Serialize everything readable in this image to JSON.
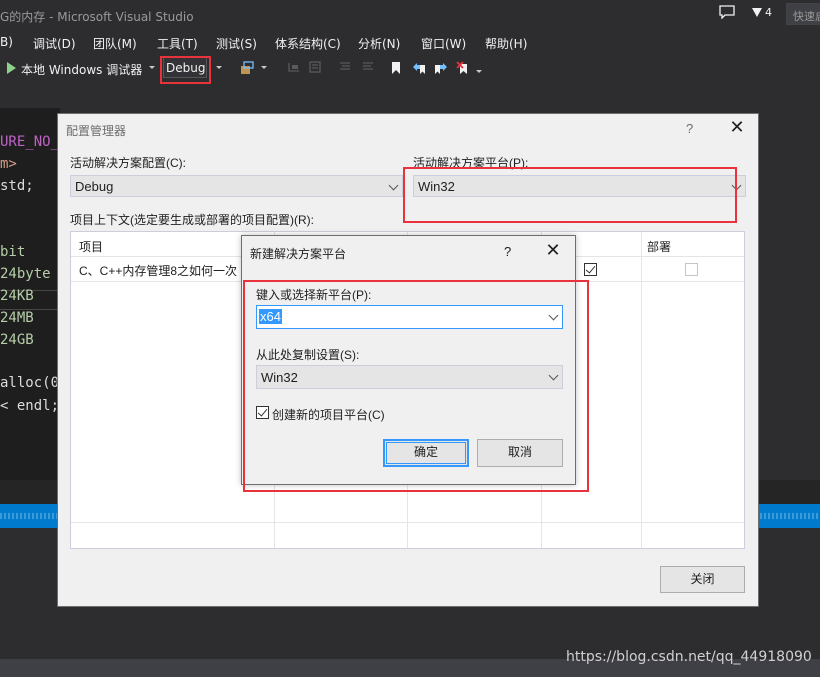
{
  "window": {
    "title": "G的内存 - Microsoft Visual Studio",
    "notification_count": "4",
    "quick_launch": "快速启"
  },
  "menu": {
    "items": [
      "B)",
      "调试(D)",
      "团队(M)",
      "工具(T)",
      "测试(S)",
      "体系结构(C)",
      "分析(N)",
      "窗口(W)",
      "帮助(H)"
    ]
  },
  "toolbar": {
    "run_label": "本地 Windows 调试器",
    "configuration": "Debug"
  },
  "editor": {
    "lines": [
      "URE_NO_",
      "m>",
      "std;",
      "",
      "bit",
      "24byte",
      "24KB",
      "24MB",
      "24GB",
      "",
      "alloc(0",
      "< endl;"
    ]
  },
  "config_manager": {
    "title": "配置管理器",
    "help": "?",
    "close": "✕",
    "active_config_label": "活动解决方案配置(C):",
    "active_config_value": "Debug",
    "active_platform_label": "活动解决方案平台(P):",
    "active_platform_value": "Win32",
    "project_context_label": "项目上下文(选定要生成或部署的项目配置)(R):",
    "columns": [
      "项目",
      "部署"
    ],
    "rows": [
      {
        "project": "C、C++内存管理8之如何一次",
        "build": true,
        "deploy": false
      }
    ],
    "close_button": "关闭"
  },
  "new_platform": {
    "title": "新建解决方案平台",
    "help": "?",
    "close": "✕",
    "type_label": "键入或选择新平台(P):",
    "type_value": "x64",
    "copy_label": "从此处复制设置(S):",
    "copy_value": "Win32",
    "create_label": "创建新的项目平台(C)",
    "create_checked": true,
    "ok_button": "确定",
    "cancel_button": "取消"
  },
  "watermark": "https://blog.csdn.net/qq_44918090",
  "colors": {
    "highlight": "#e8323c",
    "vs_accent": "#007acc",
    "selection": "#3399ff"
  }
}
